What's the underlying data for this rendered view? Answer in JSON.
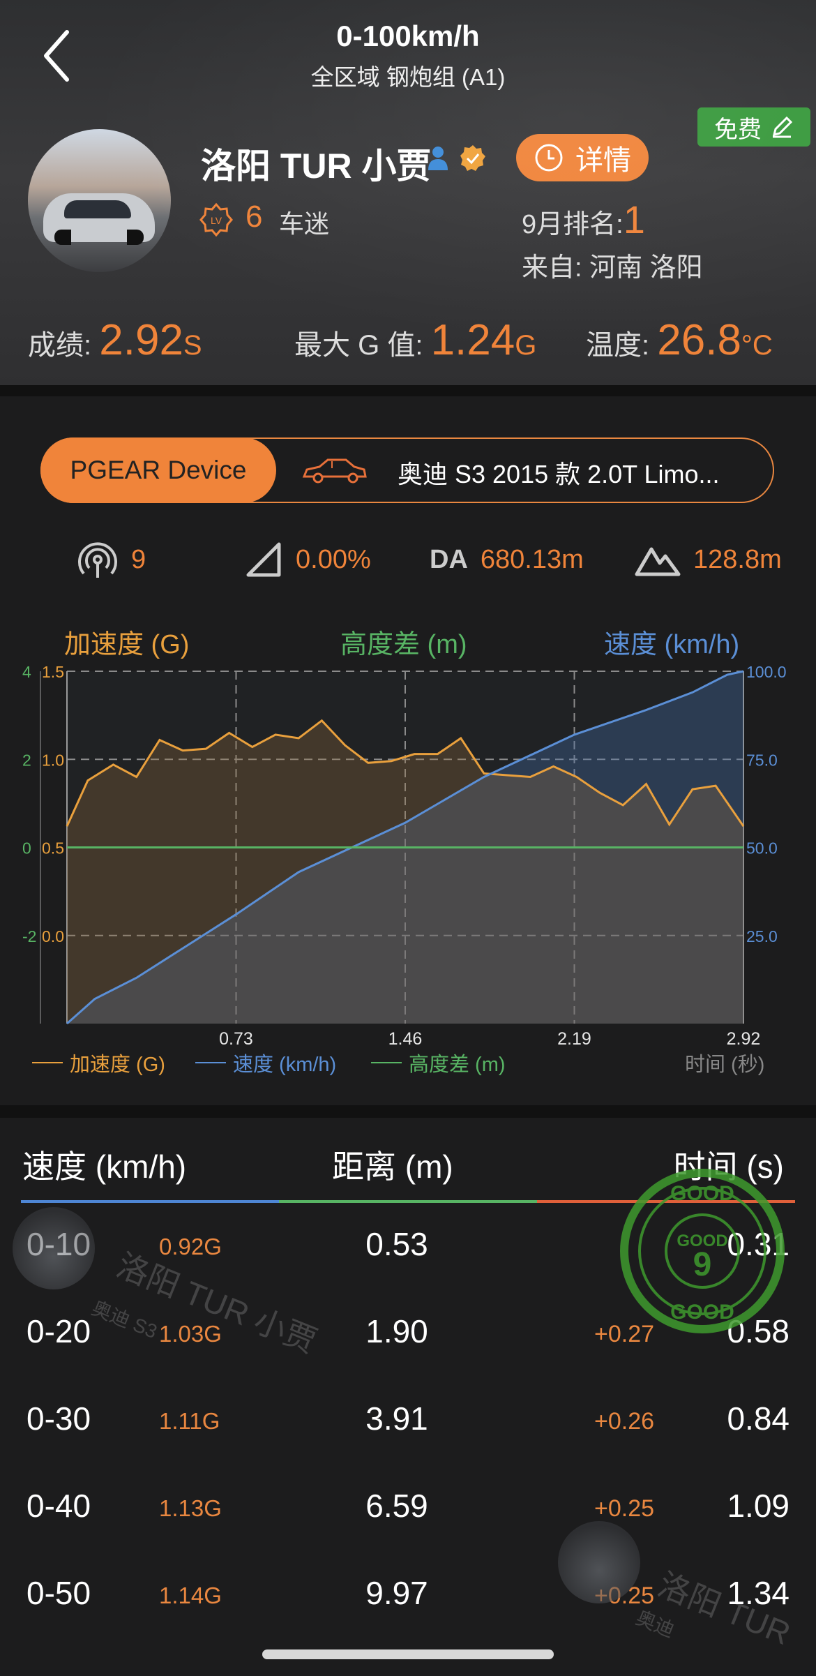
{
  "header": {
    "title": "0-100km/h",
    "subtitle": "全区域  钢炮组 (A1)",
    "free_label": "免费",
    "username": "洛阳 TUR 小贾",
    "detail_label": "详情",
    "level": "6",
    "level_name": "车迷",
    "rank_label": "9月排名:",
    "rank_value": "1",
    "from": "来自: 河南 洛阳",
    "score_label": "成绩:",
    "score_value": "2.92",
    "score_unit": "S",
    "g_label": "最大 G 值:",
    "g_value": "1.24",
    "g_unit": "G",
    "temp_label": "温度:",
    "temp_value": "26.8",
    "temp_unit": "°C"
  },
  "device": {
    "pill_label": "PGEAR Device",
    "car_name": "奥迪 S3 2015 款 2.0T Limo..."
  },
  "info": {
    "satellites": "9",
    "slope": "0.00%",
    "da_label": "DA",
    "da_value": "680.13m",
    "altitude": "128.8m"
  },
  "chart_data": {
    "type": "line",
    "header_left": "加速度 (G)",
    "header_mid": "高度差 (m)",
    "header_right": "速度 (km/h)",
    "x_ticks": [
      "0.73",
      "1.46",
      "2.19",
      "2.92"
    ],
    "x_max": 2.92,
    "xlabel": "时间 (秒)",
    "left_axis_alt": [
      "4",
      "2",
      "0",
      "-2"
    ],
    "left_axis_g": [
      "1.5",
      "1.0",
      "0.5",
      "0.0"
    ],
    "right_axis": [
      "100.0",
      "75.0",
      "50.0",
      "25.0"
    ],
    "g_ylim": [
      -0.5,
      1.5
    ],
    "speed_ylim": [
      0,
      100
    ],
    "series": [
      {
        "name": "加速度 (G)",
        "color": "#e9a03d",
        "x": [
          0,
          0.09,
          0.2,
          0.3,
          0.4,
          0.5,
          0.6,
          0.7,
          0.8,
          0.9,
          1.0,
          1.1,
          1.2,
          1.3,
          1.4,
          1.5,
          1.6,
          1.7,
          1.8,
          1.9,
          2.0,
          2.1,
          2.2,
          2.3,
          2.4,
          2.5,
          2.6,
          2.7,
          2.8,
          2.92
        ],
        "values": [
          0.62,
          0.88,
          0.97,
          0.9,
          1.11,
          1.05,
          1.06,
          1.15,
          1.07,
          1.14,
          1.12,
          1.22,
          1.08,
          0.98,
          0.99,
          1.03,
          1.03,
          1.12,
          0.92,
          0.91,
          0.9,
          0.96,
          0.9,
          0.81,
          0.74,
          0.86,
          0.63,
          0.83,
          0.85,
          0.62
        ]
      },
      {
        "name": "速度 (km/h)",
        "color": "#5b8fd6",
        "x": [
          0,
          0.12,
          0.3,
          0.73,
          1.0,
          1.46,
          1.8,
          2.19,
          2.5,
          2.7,
          2.85,
          2.92
        ],
        "values": [
          0,
          7,
          13,
          31,
          43,
          57,
          70,
          82,
          89,
          94,
          99,
          100
        ]
      },
      {
        "name": "高度差 (m)",
        "color": "#58b464",
        "x": [
          0,
          2.92
        ],
        "values": [
          0,
          0
        ]
      }
    ],
    "legend": [
      "加速度 (G)",
      "速度 (km/h)",
      "高度差 (m)"
    ]
  },
  "table": {
    "headers": [
      "速度 (km/h)",
      "距离 (m)",
      "时间 (s)"
    ],
    "rows": [
      {
        "range": "0-10",
        "g": "0.92G",
        "dist": "0.53",
        "delta": "",
        "time": "0.31"
      },
      {
        "range": "0-20",
        "g": "1.03G",
        "dist": "1.90",
        "delta": "+0.27",
        "time": "0.58"
      },
      {
        "range": "0-30",
        "g": "1.11G",
        "dist": "3.91",
        "delta": "+0.26",
        "time": "0.84"
      },
      {
        "range": "0-40",
        "g": "1.13G",
        "dist": "6.59",
        "delta": "+0.25",
        "time": "1.09"
      },
      {
        "range": "0-50",
        "g": "1.14G",
        "dist": "9.97",
        "delta": "+0.25",
        "time": "1.34"
      }
    ]
  },
  "stamp": {
    "top": "GOOD",
    "number": "9"
  },
  "watermark": {
    "name": "洛阳 TUR 小贾",
    "sub": "奥迪 S3",
    "name2": "洛阳 TUR",
    "sub2": "奥迪"
  },
  "colors": {
    "accent": "#f0843a",
    "speed": "#5b8fd6",
    "altitude": "#58b464",
    "accel": "#e9a03d"
  }
}
